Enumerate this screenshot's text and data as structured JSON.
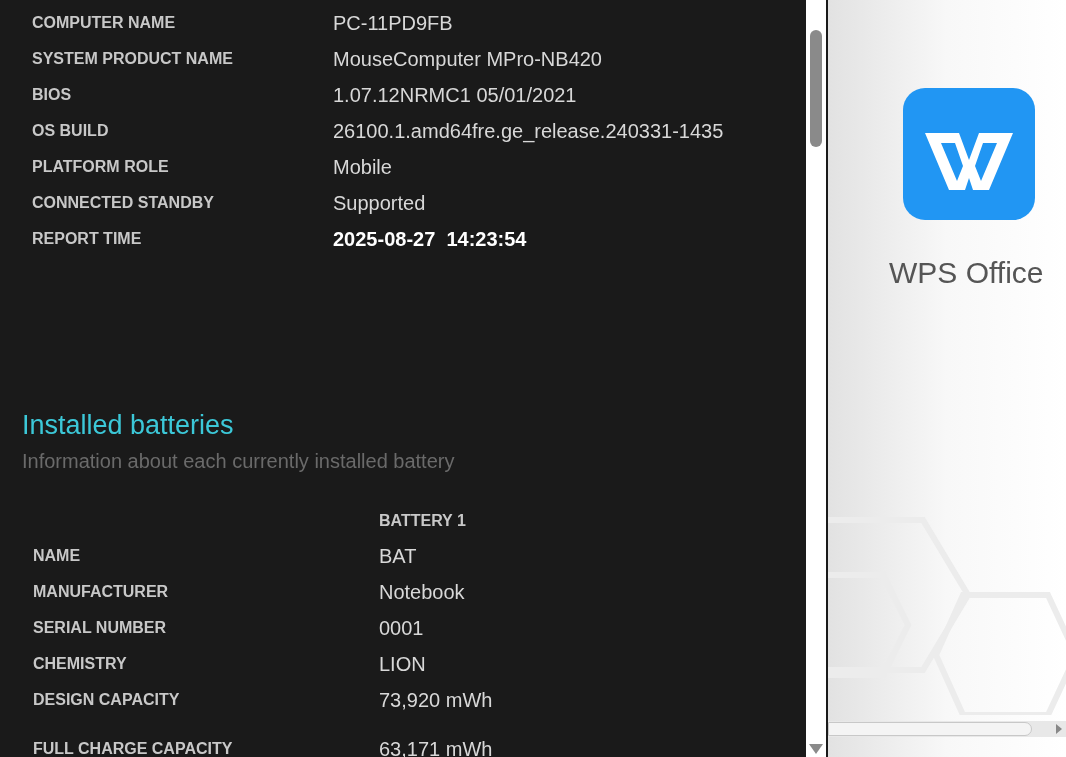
{
  "system_info": [
    {
      "label": "COMPUTER NAME",
      "value": "PC-11PD9FB",
      "kind": "plain"
    },
    {
      "label": "SYSTEM PRODUCT NAME",
      "value": "MouseComputer MPro-NB420",
      "kind": "plain"
    },
    {
      "label": "BIOS",
      "value": "1.07.12NRMC1 05/01/2021",
      "kind": "plain"
    },
    {
      "label": "OS BUILD",
      "value": "26100.1.amd64fre.ge_release.240331-1435",
      "kind": "plain"
    },
    {
      "label": "PLATFORM ROLE",
      "value": "Mobile",
      "kind": "plain"
    },
    {
      "label": "CONNECTED STANDBY",
      "value": "Supported",
      "kind": "plain"
    },
    {
      "label": "REPORT TIME",
      "value": "2025-08-27  14:23:54",
      "kind": "emphasis"
    }
  ],
  "installed_batteries": {
    "title": "Installed batteries",
    "subtitle": "Information about each currently installed battery",
    "column_header": "BATTERY 1",
    "rows": [
      {
        "label": "NAME",
        "value": "BAT"
      },
      {
        "label": "MANUFACTURER",
        "value": "Notebook"
      },
      {
        "label": "SERIAL NUMBER",
        "value": "0001"
      },
      {
        "label": "CHEMISTRY",
        "value": "LION"
      },
      {
        "label": "DESIGN CAPACITY",
        "value": "73,920 mWh"
      },
      {
        "label": "FULL CHARGE CAPACITY",
        "value": "63,171 mWh"
      }
    ]
  },
  "app_tile": {
    "label": "WPS Office"
  }
}
